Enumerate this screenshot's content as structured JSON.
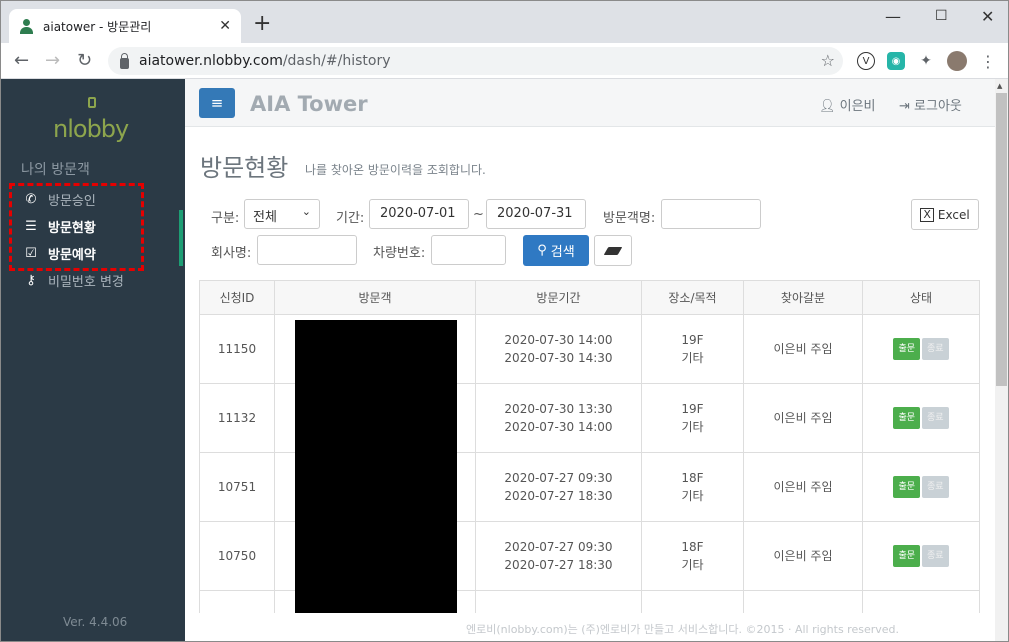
{
  "browser": {
    "tab_title": "aiatower - 방문관리",
    "url_host": "aiatower.nlobby.com",
    "url_path": "/dash/#/history"
  },
  "sidebar": {
    "logo": "nlobby",
    "section": "나의 방문객",
    "items": [
      {
        "label": "방문승인",
        "icon": "phone-icon"
      },
      {
        "label": "방문현황",
        "icon": "list-icon"
      },
      {
        "label": "방문예약",
        "icon": "calendar-check-icon"
      },
      {
        "label": "비밀번호 변경",
        "icon": "key-icon"
      }
    ],
    "version": "Ver. 4.4.06"
  },
  "header": {
    "brand": "AIA Tower",
    "user": "이은비",
    "logout": "로그아웃"
  },
  "page": {
    "title": "방문현황",
    "subtitle": "나를 찾아온 방문이력을 조회합니다."
  },
  "filters": {
    "type_label": "구분:",
    "type_value": "전체",
    "period_label": "기간:",
    "date_from": "2020-07-01",
    "tilde": "~",
    "date_to": "2020-07-31",
    "visitor_label": "방문객명:",
    "visitor_value": "",
    "company_label": "회사명:",
    "company_value": "",
    "car_label": "차량번호:",
    "car_value": "",
    "search_label": "검색",
    "excel_label": "Excel"
  },
  "table": {
    "headers": [
      "신청ID",
      "방문객",
      "방문기간",
      "장소/목적",
      "찾아갈분",
      "상태"
    ],
    "rows": [
      {
        "id": "11150",
        "start": "2020-07-30 14:00",
        "end": "2020-07-30 14:30",
        "floor": "19F",
        "purpose": "기타",
        "host": "이은비 주임",
        "status_out": "출문",
        "status_end": "종료"
      },
      {
        "id": "11132",
        "start": "2020-07-30 13:30",
        "end": "2020-07-30 14:00",
        "floor": "19F",
        "purpose": "기타",
        "host": "이은비 주임",
        "status_out": "출문",
        "status_end": "종료"
      },
      {
        "id": "10751",
        "start": "2020-07-27 09:30",
        "end": "2020-07-27 18:30",
        "floor": "18F",
        "purpose": "기타",
        "host": "이은비 주임",
        "status_out": "출문",
        "status_end": "종료"
      },
      {
        "id": "10750",
        "start": "2020-07-27 09:30",
        "end": "2020-07-27 18:30",
        "floor": "18F",
        "purpose": "기타",
        "host": "이은비 주임",
        "status_out": "출문",
        "status_end": "종료"
      }
    ]
  },
  "footer": "엔로비(nlobby.com)는 (주)엔로비가 만들고 서비스합니다. ©2015 · All rights reserved."
}
